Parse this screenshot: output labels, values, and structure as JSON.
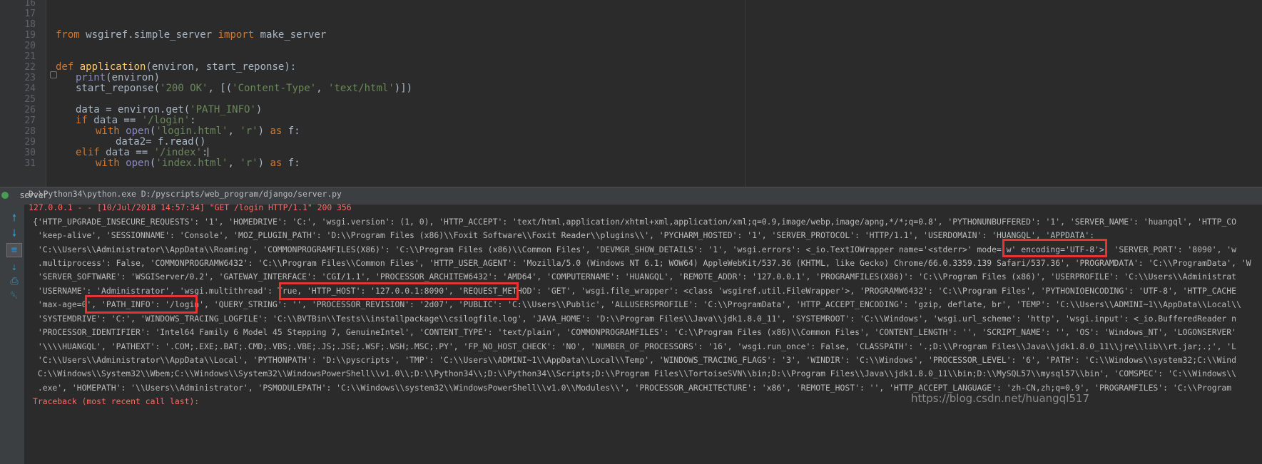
{
  "editor": {
    "line_numbers": [
      "16",
      "17",
      "18",
      "19",
      "20",
      "21",
      "22",
      "23",
      "24",
      "25",
      "26",
      "27",
      "28",
      "29",
      "30",
      "31"
    ]
  },
  "run_panel": {
    "title": "server"
  },
  "toolbar": {
    "icons": [
      "arrow-up-icon",
      "arrow-down-icon",
      "soft-wrap-icon",
      "scroll-to-end-icon",
      "print-icon",
      "trash-icon"
    ]
  },
  "console": {
    "command": "D:\\Python34\\python.exe D:/pyscripts/web_program/django/server.py",
    "request_log": "127.0.0.1 - - [10/Jul/2018 14:57:34] \"GET /login HTTP/1.1\" 200 356",
    "lines": [
      "{'HTTP_UPGRADE_INSECURE_REQUESTS': '1', 'HOMEDRIVE': 'C:', 'wsgi.version': (1, 0), 'HTTP_ACCEPT': 'text/html,application/xhtml+xml,application/xml;q=0.9,image/webp,image/apng,*/*;q=0.8', 'PYTHONUNBUFFERED': '1', 'SERVER_NAME': 'huangql', 'HTTP_CO",
      " 'keep-alive', 'SESSIONNAME': 'Console', 'MOZ_PLUGIN_PATH': 'D:\\\\Program Files (x86)\\\\Foxit Software\\\\Foxit Reader\\\\plugins\\\\', 'PYCHARM_HOSTED': '1', 'SERVER_PROTOCOL': 'HTTP/1.1', 'USERDOMAIN': 'HUANGQL', 'APPDATA':",
      " 'C:\\\\Users\\\\Administrator\\\\AppData\\\\Roaming', 'COMMONPROGRAMFILES(X86)': 'C:\\\\Program Files (x86)\\\\Common Files', 'DEVMGR_SHOW_DETAILS': '1', 'wsgi.errors': <_io.TextIOWrapper name='<stderr>' mode='w' encoding='UTF-8'>, 'SERVER_PORT': '8090', 'w",
      " .multiprocess': False, 'COMMONPROGRAMW6432': 'C:\\\\Program Files\\\\Common Files', 'HTTP_USER_AGENT': 'Mozilla/5.0 (Windows NT 6.1; WOW64) AppleWebKit/537.36 (KHTML, like Gecko) Chrome/66.0.3359.139 Safari/537.36', 'PROGRAMDATA': 'C:\\\\ProgramData', 'W",
      " 'SERVER_SOFTWARE': 'WSGIServer/0.2', 'GATEWAY_INTERFACE': 'CGI/1.1', 'PROCESSOR_ARCHITEW6432': 'AMD64', 'COMPUTERNAME': 'HUANGQL', 'REMOTE_ADDR': '127.0.0.1', 'PROGRAMFILES(X86)': 'C:\\\\Program Files (x86)', 'USERPROFILE': 'C:\\\\Users\\\\Administrat",
      " 'USERNAME': 'Administrator', 'wsgi.multithread': True, 'HTTP_HOST': '127.0.0.1:8090', 'REQUEST_METHOD': 'GET', 'wsgi.file_wrapper': <class 'wsgiref.util.FileWrapper'>, 'PROGRAMW6432': 'C:\\\\Program Files', 'PYTHONIOENCODING': 'UTF-8', 'HTTP_CACHE",
      " 'max-age=0', 'PATH_INFO': '/login', 'QUERY_STRING': '', 'PROCESSOR_REVISION': '2d07', 'PUBLIC': 'C:\\\\Users\\\\Public', 'ALLUSERSPROFILE': 'C:\\\\ProgramData', 'HTTP_ACCEPT_ENCODING': 'gzip, deflate, br', 'TEMP': 'C:\\\\Users\\\\ADMINI~1\\\\AppData\\\\Local\\\\",
      " 'SYSTEMDRIVE': 'C:', 'WINDOWS_TRACING_LOGFILE': 'C:\\\\BVTBin\\\\Tests\\\\installpackage\\\\csilogfile.log', 'JAVA_HOME': 'D:\\\\Program Files\\\\Java\\\\jdk1.8.0_11', 'SYSTEMROOT': 'C:\\\\Windows', 'wsgi.url_scheme': 'http', 'wsgi.input': <_io.BufferedReader n",
      " 'PROCESSOR_IDENTIFIER': 'Intel64 Family 6 Model 45 Stepping 7, GenuineIntel', 'CONTENT_TYPE': 'text/plain', 'COMMONPROGRAMFILES': 'C:\\\\Program Files (x86)\\\\Common Files', 'CONTENT_LENGTH': '', 'SCRIPT_NAME': '', 'OS': 'Windows_NT', 'LOGONSERVER'",
      " '\\\\\\\\HUANGQL', 'PATHEXT': '.COM;.EXE;.BAT;.CMD;.VBS;.VBE;.JS;.JSE;.WSF;.WSH;.MSC;.PY', 'FP_NO_HOST_CHECK': 'NO', 'NUMBER_OF_PROCESSORS': '16', 'wsgi.run_once': False, 'CLASSPATH': '.;D:\\\\Program Files\\\\Java\\\\jdk1.8.0_11\\\\jre\\\\lib\\\\rt.jar;.;', 'L",
      " 'C:\\\\Users\\\\Administrator\\\\AppData\\\\Local', 'PYTHONPATH': 'D:\\\\pyscripts', 'TMP': 'C:\\\\Users\\\\ADMINI~1\\\\AppData\\\\Local\\\\Temp', 'WINDOWS_TRACING_FLAGS': '3', 'WINDIR': 'C:\\\\Windows', 'PROCESSOR_LEVEL': '6', 'PATH': 'C:\\\\Windows\\\\system32;C:\\\\Wind",
      " C:\\\\Windows\\\\System32\\\\Wbem;C:\\\\Windows\\\\System32\\\\WindowsPowerShell\\\\v1.0\\\\;D:\\\\Python34\\\\;D:\\\\Python34\\\\Scripts;D:\\\\Program Files\\\\TortoiseSVN\\\\bin;D:\\\\Program Files\\\\Java\\\\jdk1.8.0_11\\\\bin;D:\\\\MySQL57\\\\mysql57\\\\bin', 'COMSPEC': 'C:\\\\Windows\\\\",
      " .exe', 'HOMEPATH': '\\\\Users\\\\Administrator', 'PSMODULEPATH': 'C:\\\\Windows\\\\system32\\\\WindowsPowerShell\\\\v1.0\\\\Modules\\\\', 'PROCESSOR_ARCHITECTURE': 'x86', 'REMOTE_HOST': '', 'HTTP_ACCEPT_LANGUAGE': 'zh-CN,zh;q=0.9', 'PROGRAMFILES': 'C:\\\\Program"
    ],
    "traceback": "Traceback (most recent call last):"
  },
  "watermark": "https://blog.csdn.net/huangql517",
  "colors": {
    "editor_bg": "#2b2b2b",
    "keyword": "#cc7832",
    "string": "#6a8759",
    "function": "#ffc66d",
    "error": "#ff6b68",
    "highlight_box": "#e63333"
  }
}
